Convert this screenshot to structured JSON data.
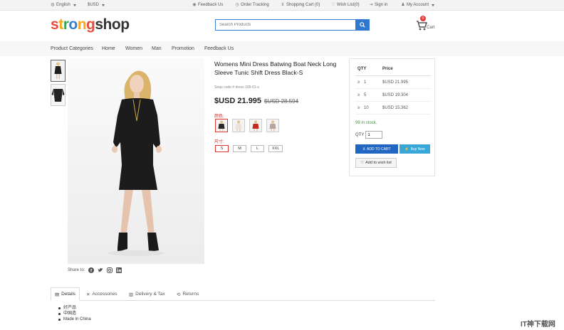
{
  "topbar": {
    "language": "English",
    "currency": "$USD",
    "feedback": "Feedback Us",
    "order_tracking": "Order Tracking",
    "shopping_cart": "Shopping Cart (0)",
    "wish_list": "Wish List(0)",
    "sign_in": "Sign in",
    "my_account": "My Account"
  },
  "logo": {
    "parts": [
      "s",
      "t",
      "r",
      "o",
      "n",
      "g",
      "shop"
    ],
    "colors": [
      "#e94b3c",
      "#f5a623",
      "#3aa757",
      "#2f7ed8",
      "#f5a623",
      "#e94b3c",
      "#333333"
    ]
  },
  "search": {
    "placeholder": "Search Products"
  },
  "cart": {
    "count": "0",
    "label": "Cart"
  },
  "nav": [
    "Product Categories",
    "Home",
    "Women",
    "Man",
    "Promotion",
    "Feedback Us"
  ],
  "product": {
    "title": "Womens Mini Dress Batwing Boat Neck Long Sleeve Tunic Shift Dress Black-S",
    "sku": "Sequ code # dress 100-01-s",
    "price": "$USD 21.995",
    "old_price": "$USD 28.594",
    "color_label": "颜色:",
    "size_label": "尺寸:",
    "swatch_colors": [
      "#2a2a2a",
      "#e8e4dc",
      "#c62828",
      "#b8a49a"
    ],
    "sizes": [
      "S",
      "M",
      "L",
      "XXL"
    ]
  },
  "buybox": {
    "qty_header": "QTY",
    "price_header": "Price",
    "tiers": [
      {
        "op": "≥",
        "qty": "1",
        "price": "$USD 21.995"
      },
      {
        "op": "≥",
        "qty": "5",
        "price": "$USD 19.304"
      },
      {
        "op": "≥",
        "qty": "10",
        "price": "$USD 15.362"
      }
    ],
    "stock": "99 in stock.",
    "qty_label": "QTY",
    "qty_value": "1",
    "add_to_cart": "ADD TO CART",
    "buy_now": "Buy Now",
    "wish": "Add to wish list"
  },
  "share": {
    "label": "Share to:"
  },
  "tabs": [
    "Details",
    "Accessories",
    "Delivery & Tax",
    "Returns"
  ],
  "details": [
    "好产品",
    "中国造",
    "Made in China"
  ],
  "watermark": "IT神下载网"
}
